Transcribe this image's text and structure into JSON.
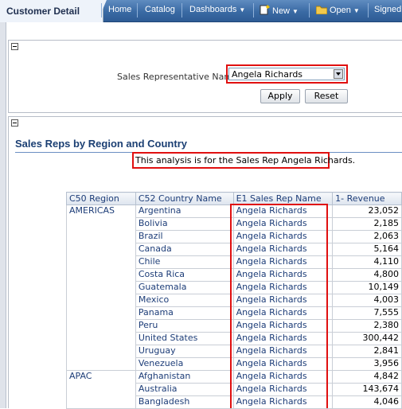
{
  "topbar": {
    "active_tab": "Customer Detail",
    "nav": {
      "home": "Home",
      "catalog": "Catalog",
      "dashboards": "Dashboards",
      "new": "New",
      "open": "Open",
      "signed": "Signed"
    }
  },
  "prompt": {
    "label": "Sales Representative Name:",
    "selected": "Angela Richards",
    "apply": "Apply",
    "reset": "Reset"
  },
  "report": {
    "title": "Sales Reps by Region and Country",
    "narrative": "This analysis is for the Sales Rep Angela Richards.",
    "columns": [
      "C50 Region",
      "C52 Country Name",
      "E1 Sales Rep Name",
      "1- Revenue"
    ],
    "rows": [
      [
        "AMERICAS",
        "Argentina",
        "Angela Richards",
        "23,052"
      ],
      [
        "",
        "Bolivia",
        "Angela Richards",
        "2,185"
      ],
      [
        "",
        "Brazil",
        "Angela Richards",
        "2,063"
      ],
      [
        "",
        "Canada",
        "Angela Richards",
        "5,164"
      ],
      [
        "",
        "Chile",
        "Angela Richards",
        "4,110"
      ],
      [
        "",
        "Costa Rica",
        "Angela Richards",
        "4,800"
      ],
      [
        "",
        "Guatemala",
        "Angela Richards",
        "10,149"
      ],
      [
        "",
        "Mexico",
        "Angela Richards",
        "4,003"
      ],
      [
        "",
        "Panama",
        "Angela Richards",
        "7,555"
      ],
      [
        "",
        "Peru",
        "Angela Richards",
        "2,380"
      ],
      [
        "",
        "United States",
        "Angela Richards",
        "300,442"
      ],
      [
        "",
        "Uruguay",
        "Angela Richards",
        "2,841"
      ],
      [
        "",
        "Venezuela",
        "Angela Richards",
        "3,956"
      ],
      [
        "APAC",
        "Afghanistan",
        "Angela Richards",
        "4,842"
      ],
      [
        "",
        "Australia",
        "Angela Richards",
        "143,674"
      ],
      [
        "",
        "Bangladesh",
        "Angela Richards",
        "4,046"
      ]
    ]
  }
}
